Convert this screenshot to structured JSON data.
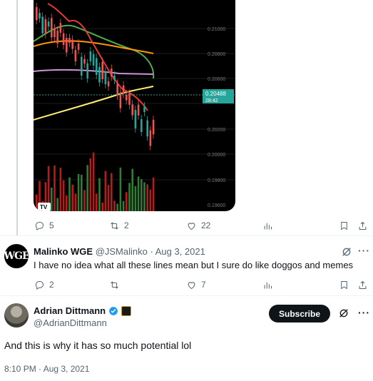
{
  "chart": {
    "price_labels": [
      "0.21000",
      "0.20800",
      "0.20600",
      "0.20400",
      "0.20200",
      "0.20000",
      "0.19800",
      "0.19600"
    ],
    "current_price": "0.20488",
    "countdown": "28:42",
    "logo_text": "TV"
  },
  "tweet1_actions": {
    "replies": "5",
    "reposts": "2",
    "likes": "22"
  },
  "reply": {
    "name": "Malinko WGE",
    "avatar_text": "WGE",
    "handle": "@JSMalinko",
    "separator": "·",
    "date": "Aug 3, 2021",
    "text": "I have no idea what all these lines mean but I sure do like doggos and memes",
    "replies": "2",
    "reposts": "",
    "likes": "7"
  },
  "main": {
    "name": "Adrian Dittmann",
    "handle": "@AdrianDittmann",
    "subscribe_label": "Subscribe",
    "text": "And this is why it has so much potential lol",
    "timestamp": "8:10 PM · Aug 3, 2021"
  },
  "colors": {
    "accent": "#1d9bf0",
    "up": "#26a69a",
    "down": "#ef5350",
    "text": "#0f1419",
    "muted": "#536471"
  },
  "icons": [
    "reply-icon",
    "repost-icon",
    "like-icon",
    "views-icon",
    "bookmark-icon",
    "share-icon",
    "grok-icon",
    "more-icon",
    "verified-icon"
  ]
}
